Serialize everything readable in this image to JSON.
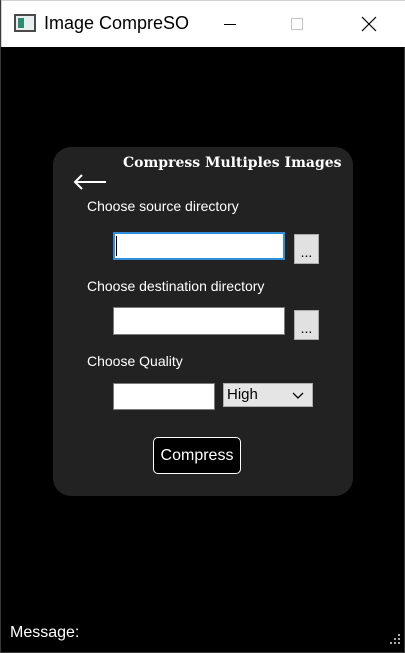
{
  "window": {
    "title": "Image CompreSO",
    "icon": "app-window-icon"
  },
  "card": {
    "heading": "Compress Multiples Images",
    "back_icon": "back-arrow-icon",
    "source": {
      "label": "Choose source directory",
      "value": "",
      "browse_label": "..."
    },
    "destination": {
      "label": "Choose destination directory",
      "value": "",
      "browse_label": "..."
    },
    "quality": {
      "label": "Choose Quality",
      "value": "",
      "selected_option": "High"
    },
    "compress_label": "Compress"
  },
  "status": {
    "message_label": "Message:"
  },
  "colors": {
    "background": "#000000",
    "card": "#222222",
    "focus_border": "#2f8fd8"
  }
}
